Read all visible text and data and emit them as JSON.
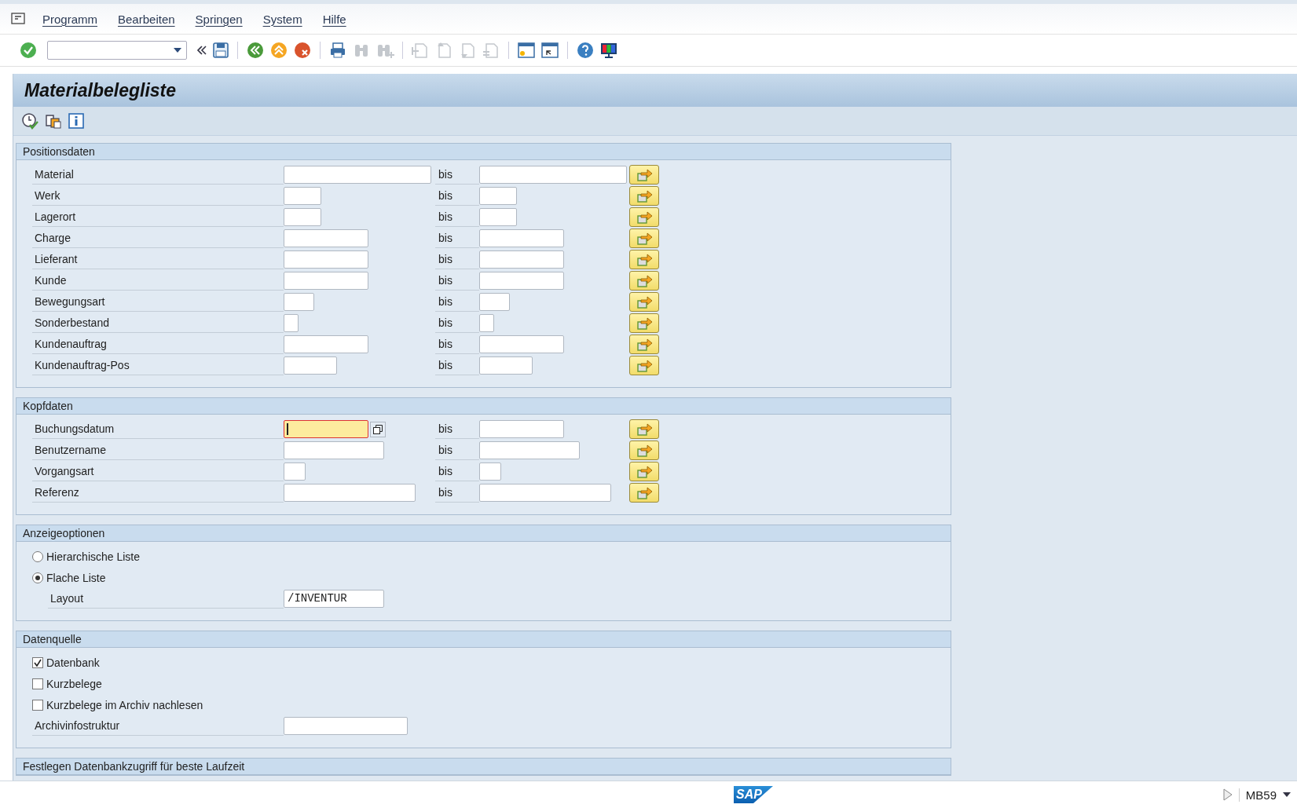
{
  "menu": [
    {
      "label": "Programm"
    },
    {
      "label": "Bearbeiten"
    },
    {
      "label": "Springen"
    },
    {
      "label": "System"
    },
    {
      "label": "Hilfe"
    }
  ],
  "title": "Materialbelegliste",
  "groups": [
    {
      "kind": "range",
      "title": "Positionsdaten",
      "rows": [
        {
          "label": "Material",
          "to_label": "bis"
        },
        {
          "label": "Werk",
          "to_label": "bis"
        },
        {
          "label": "Lagerort",
          "to_label": "bis"
        },
        {
          "label": "Charge",
          "to_label": "bis"
        },
        {
          "label": "Lieferant",
          "to_label": "bis"
        },
        {
          "label": "Kunde",
          "to_label": "bis"
        },
        {
          "label": "Bewegungsart",
          "to_label": "bis"
        },
        {
          "label": "Sonderbestand",
          "to_label": "bis"
        },
        {
          "label": "Kundenauftrag",
          "to_label": "bis"
        },
        {
          "label": "Kundenauftrag-Pos",
          "to_label": "bis"
        }
      ]
    },
    {
      "kind": "range",
      "title": "Kopfdaten",
      "rows": [
        {
          "label": "Buchungsdatum",
          "to_label": "bis",
          "focused": true
        },
        {
          "label": "Benutzername",
          "to_label": "bis",
          "focused": false
        },
        {
          "label": "Vorgangsart",
          "to_label": "bis",
          "focused": false
        },
        {
          "label": "Referenz",
          "to_label": "bis",
          "focused": false
        }
      ]
    },
    {
      "kind": "options",
      "title": "Anzeigeoptionen",
      "rows": [
        {
          "kind": "radio",
          "label": "Hierarchische Liste",
          "selected": false
        },
        {
          "kind": "radio",
          "label": "Flache Liste",
          "selected": true
        },
        {
          "kind": "field",
          "label": "Layout",
          "value": "/INVENTUR"
        }
      ]
    },
    {
      "kind": "options",
      "title": "Datenquelle",
      "rows": [
        {
          "kind": "checkbox",
          "label": "Datenbank",
          "checked": true
        },
        {
          "kind": "checkbox",
          "label": "Kurzbelege",
          "checked": false
        },
        {
          "kind": "checkbox",
          "label": "Kurzbelege im Archiv nachlesen",
          "checked": false
        },
        {
          "kind": "field",
          "label": "Archivinfostruktur",
          "value": ""
        }
      ]
    },
    {
      "kind": "header",
      "title": "Festlegen Datenbankzugriff für beste Laufzeit"
    }
  ],
  "status": {
    "logo": "SAP",
    "transaction": "MB59"
  }
}
